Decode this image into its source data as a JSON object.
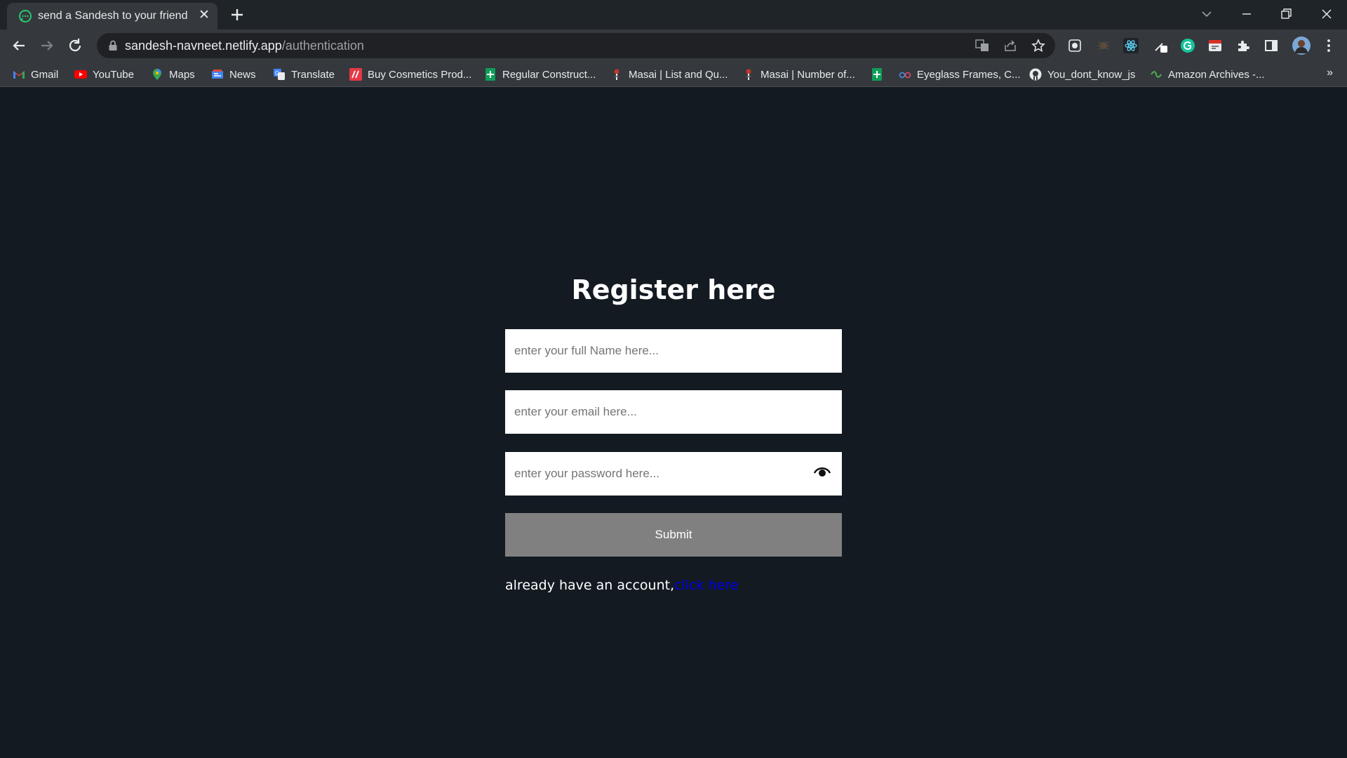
{
  "browser": {
    "tab": {
      "title": "send a Sandesh to your friend",
      "close_glyph": "✕",
      "favicon": "chat-bubble-icon"
    },
    "address": {
      "host": "sandesh-navneet.netlify.app",
      "path": "/authentication"
    },
    "bookmarks": [
      {
        "label": "Gmail",
        "icon": "gmail-icon"
      },
      {
        "label": "YouTube",
        "icon": "youtube-icon"
      },
      {
        "label": "Maps",
        "icon": "maps-icon"
      },
      {
        "label": "News",
        "icon": "news-icon"
      },
      {
        "label": "Translate",
        "icon": "translate-icon"
      },
      {
        "label": "Buy Cosmetics Prod...",
        "icon": "cosmetics-icon"
      },
      {
        "label": "Regular Construct...",
        "icon": "sheets-icon"
      },
      {
        "label": "Masai | List and Qu...",
        "icon": "masai-icon"
      },
      {
        "label": "Masai | Number of...",
        "icon": "masai-icon"
      },
      {
        "label": "",
        "icon": "sheets-icon"
      },
      {
        "label": "Eyeglass Frames, C...",
        "icon": "eyeglass-icon"
      },
      {
        "label": "You_dont_know_js",
        "icon": "github-icon"
      },
      {
        "label": "Amazon Archives -...",
        "icon": "amazon-archives-icon"
      }
    ],
    "bookmarks_more": "»"
  },
  "form": {
    "heading": "Register here",
    "name_placeholder": "enter your full Name here...",
    "email_placeholder": "enter your email here...",
    "password_placeholder": "enter your password here...",
    "submit_label": "Submit",
    "account_text": "already have an account,",
    "login_link": "click here"
  },
  "colors": {
    "page_background": "#131a22",
    "submit_background": "#808080",
    "link": "#0000ee"
  }
}
